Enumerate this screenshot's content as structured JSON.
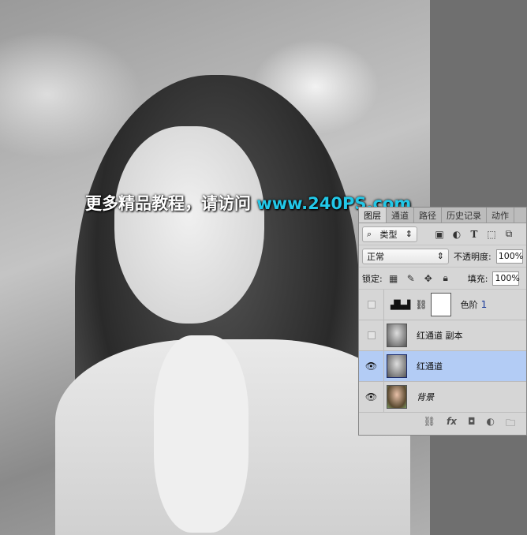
{
  "watermark": {
    "text": "更多精品教程，请访问",
    "url": "www.240PS.com"
  },
  "panel": {
    "tabs": [
      "图层",
      "通道",
      "路径",
      "历史记录",
      "动作"
    ],
    "filter": {
      "label": "类型"
    },
    "blend_mode": "正常",
    "opacity_label": "不透明度:",
    "opacity": "100%",
    "lock_label": "锁定:",
    "fill_label": "填充:",
    "fill": "100%",
    "layers": [
      {
        "name": "色阶",
        "num": "1",
        "visible": false
      },
      {
        "name": "红通道 副本",
        "visible": false
      },
      {
        "name": "红通道",
        "visible": true,
        "selected": true
      },
      {
        "name": "背景",
        "visible": true
      }
    ]
  }
}
